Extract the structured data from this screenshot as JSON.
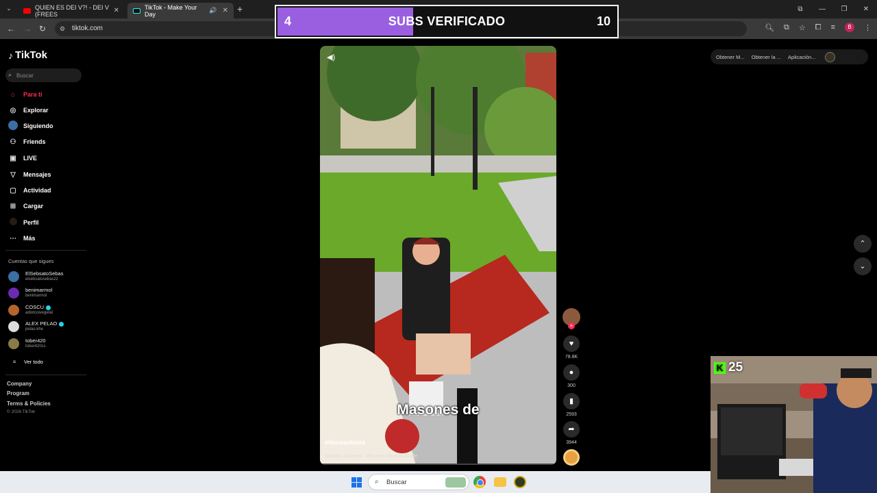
{
  "browser": {
    "tabs": [
      {
        "title": "QUIEN ES DEI V?! - DEI V (FREES",
        "close": "✕"
      },
      {
        "title": "TikTok - Make Your Day",
        "close": "✕"
      }
    ],
    "new_tab": "+",
    "url": "tiktok.com"
  },
  "overlay": {
    "left_count": "4",
    "label": "SUBS VERIFICADO",
    "right_count": "10",
    "progress_fraction": 0.4
  },
  "sidebar": {
    "logo": "TikTok",
    "search_placeholder": "Buscar",
    "menu": [
      {
        "label": "Para ti",
        "icon": "home-icon"
      },
      {
        "label": "Explorar",
        "icon": "compass-icon"
      },
      {
        "label": "Siguiendo",
        "icon": "following-icon"
      },
      {
        "label": "Friends",
        "icon": "friends-icon"
      },
      {
        "label": "LIVE",
        "icon": "live-icon"
      },
      {
        "label": "Mensajes",
        "icon": "send-icon"
      },
      {
        "label": "Actividad",
        "icon": "inbox-icon"
      },
      {
        "label": "Cargar",
        "icon": "upload-icon"
      },
      {
        "label": "Perfil",
        "icon": "profile-icon"
      },
      {
        "label": "Más",
        "icon": "more-icon"
      }
    ],
    "following_title": "Cuentas que sigues",
    "following": [
      {
        "name": "ElSebsatoSebas",
        "handle": "elsebsatosebaszz",
        "verified": false,
        "color": "#3a6ea5"
      },
      {
        "name": "benimarmol",
        "handle": "benimarmol",
        "verified": false,
        "color": "#6a2bb0"
      },
      {
        "name": "COSCU",
        "handle": "adiotcoivegetal",
        "verified": true,
        "color": "#b5652a"
      },
      {
        "name": "ALEX PELAO",
        "handle": "pelao.khe",
        "verified": true,
        "color": "#dcdcdc"
      },
      {
        "name": "tober420",
        "handle": "tober420cs",
        "verified": false,
        "color": "#8a7a4a"
      }
    ],
    "see_all": "Ver todo",
    "footer": [
      "Company",
      "Program",
      "Terms & Policies"
    ],
    "copyright": "© 2026 TikTok"
  },
  "video": {
    "caption": "Masones de",
    "username": "ellocosebass",
    "description": "Masitas caseras  ·  #humor #broma #calle"
  },
  "actions": {
    "likes": "78.8K",
    "comments": "300",
    "saves": "2593",
    "shares": "3944"
  },
  "right_tools": {
    "items": [
      "Obtener M...",
      "Obtener la ...",
      "Aplicación..."
    ]
  },
  "webcam": {
    "kick_count": "25"
  },
  "taskbar": {
    "search": "Buscar"
  },
  "colors": {
    "tiktok_red": "#fe2c55",
    "overlay_purple": "#9a5fe0",
    "kick_green": "#53fc18"
  }
}
